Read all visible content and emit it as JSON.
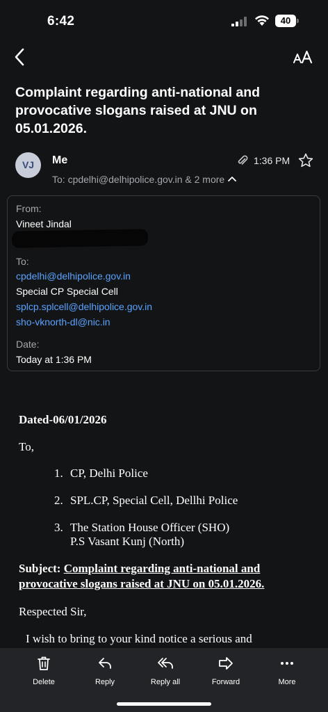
{
  "status_bar": {
    "time": "6:42",
    "battery": "40"
  },
  "email": {
    "subject": "Complaint regarding anti-national and provocative slogans raised at JNU on 05.01.2026.",
    "sender": {
      "avatar_initials": "VJ",
      "name": "Me",
      "time": "1:36 PM",
      "recipients_line": "To: cpdelhi@delhipolice.gov.in & 2 more"
    },
    "details": {
      "from_label": "From:",
      "from_name": "Vineet Jindal",
      "to_label": "To:",
      "to": [
        {
          "text": "cpdelhi@delhipolice.gov.in",
          "link": true
        },
        {
          "text": "Special CP Special Cell",
          "link": false
        },
        {
          "text": "splcp.splcell@delhipolice.gov.in",
          "link": true
        },
        {
          "text": "sho-vknorth-dl@nic.in",
          "link": true
        }
      ],
      "date_label": "Date:",
      "date_value": "Today at 1:36 PM"
    },
    "body": {
      "dated": "Dated-06/01/2026",
      "to_line": "To,",
      "list": [
        {
          "num": "1.",
          "lines": [
            "CP, Delhi Police"
          ]
        },
        {
          "num": "2.",
          "lines": [
            "SPL.CP, Special Cell, Dellhi Police"
          ]
        },
        {
          "num": "3.",
          "lines": [
            "The Station House Officer (SHO)",
            "P.S Vasant Kunj (North)"
          ]
        }
      ],
      "subject_label": "Subject:",
      "subject_line1": "Complaint regarding anti-national and",
      "subject_line2": "provocative slogans raised at JNU on 05.01.2026.",
      "greeting": "Respected Sir,",
      "para_start": "I wish to bring to your kind notice a serious and"
    }
  },
  "toolbar": {
    "delete": "Delete",
    "reply": "Reply",
    "reply_all": "Reply all",
    "forward": "Forward",
    "more": "More"
  },
  "colors": {
    "background": "#131416",
    "link": "#5aa3ff",
    "toolbar": "#232427",
    "muted": "#a6a8ad"
  }
}
